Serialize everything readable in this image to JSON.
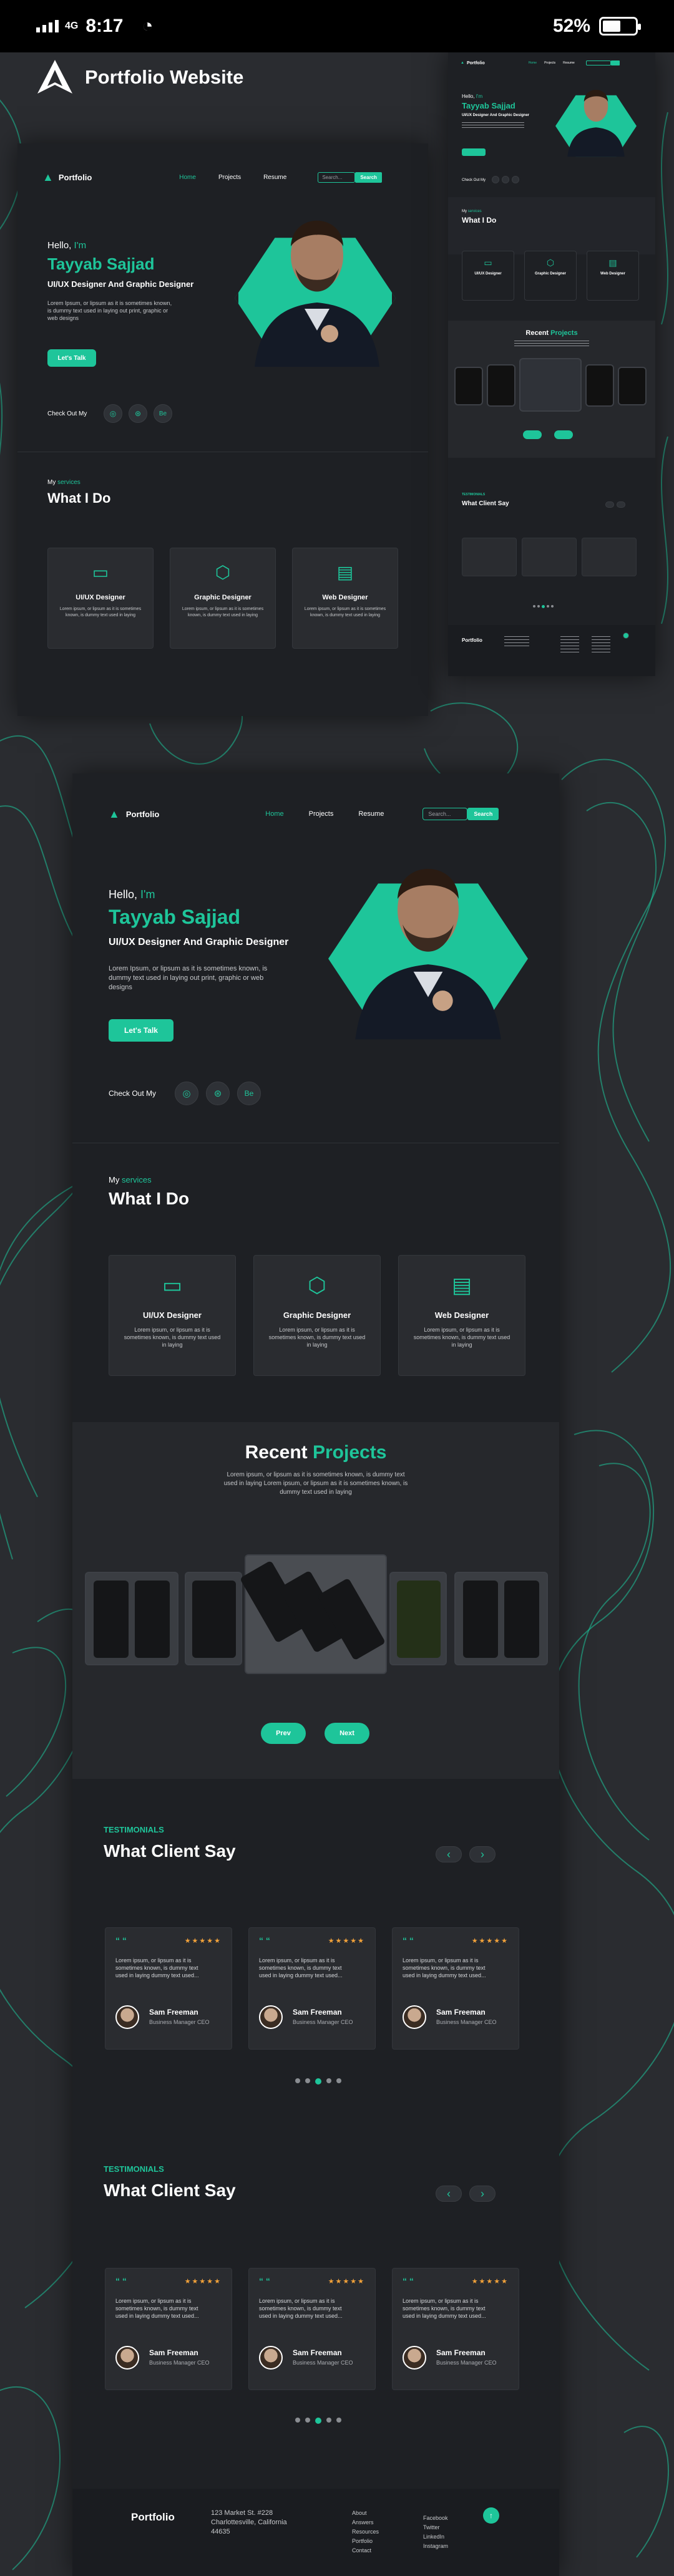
{
  "status_bar": {
    "network": "4G",
    "time": "8:17",
    "battery": "52%"
  },
  "header": {
    "title": "Portfolio Website"
  },
  "brand": {
    "name": "Portfolio"
  },
  "nav": {
    "items": [
      "Home",
      "Projects",
      "Resume"
    ],
    "search_placeholder": "Search...",
    "search_button": "Search"
  },
  "hero": {
    "greeting": "Hello,",
    "greeting_accent": "I'm",
    "name": "Tayyab Sajjad",
    "role": "UI/UX Designer And Graphic Designer",
    "intro": "Lorem Ipsum, or lipsum as it is sometimes known, is dummy text used in laying out print, graphic or web designs",
    "cta": "Let's Talk",
    "social_label": "Check Out My",
    "social_icons": [
      "instagram-icon",
      "dribbble-icon",
      "behance-icon"
    ],
    "social_glyphs": [
      "◎",
      "⊛",
      "Be"
    ]
  },
  "services": {
    "eyebrow": "My",
    "eyebrow_accent": "services",
    "title": "What I Do",
    "items": [
      {
        "title": "UI/UX Designer",
        "icon": "monitor-icon",
        "desc": "Lorem ipsum, or lipsum as it is sometimes known, is dummy text used in laying"
      },
      {
        "title": "Graphic Designer",
        "icon": "cube-icon",
        "desc": "Lorem ipsum, or lipsum as it is sometimes known, is dummy text used in laying"
      },
      {
        "title": "Web Designer",
        "icon": "devices-icon",
        "desc": "Lorem ipsum, or lipsum as it is sometimes known, is dummy text used in laying"
      }
    ]
  },
  "projects": {
    "title": "Recent",
    "title_accent": "Projects",
    "desc": "Lorem ipsum, or lipsum as it is sometimes known, is dummy text used in laying Lorem ipsum, or lipsum as it is sometimes known, is dummy text used in laying",
    "prev": "Prev",
    "next": "Next",
    "left_arrow": "‹",
    "right_arrow": "›"
  },
  "testimonials": {
    "eyebrow": "TESTIMONIALS",
    "title": "What Client Say",
    "arrow_left": "‹",
    "arrow_right": "›",
    "quote_mark": "“ “",
    "stars": "★★★★★",
    "items": [
      {
        "text": "Lorem ipsum, or lipsum as it is sometimes known, is dummy text used in laying dummy text used...",
        "name": "Sam Freeman",
        "role": "Business Manager CEO"
      },
      {
        "text": "Lorem ipsum, or lipsum as it is sometimes known, is dummy text used in laying dummy text used...",
        "name": "Sam Freeman",
        "role": "Business Manager CEO"
      },
      {
        "text": "Lorem ipsum, or lipsum as it is sometimes known, is dummy text used in laying dummy text used...",
        "name": "Sam Freeman",
        "role": "Business Manager CEO"
      }
    ]
  },
  "footer": {
    "brand": "Portfolio",
    "address": [
      "123 Market St. #228",
      "Charlottesville, California",
      "44635"
    ],
    "links_a": [
      "About",
      "Answers",
      "Resources",
      "Portfolio",
      "Contact"
    ],
    "links_b": [
      "Facebook",
      "Twitter",
      "LinkedIn",
      "Instagram"
    ],
    "up_arrow": "↑"
  },
  "colors": {
    "accent": "#1ec59a",
    "bg": "#1e2024",
    "card": "#2a2c30",
    "star": "#f2a23a"
  }
}
